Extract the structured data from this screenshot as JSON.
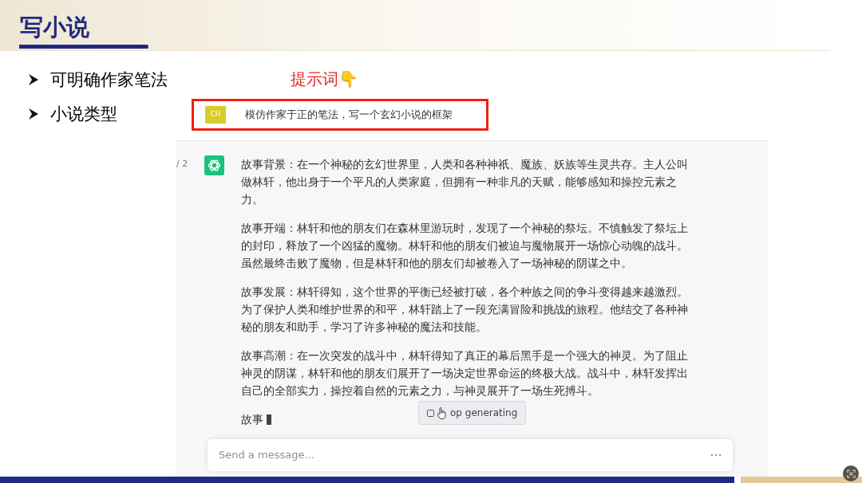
{
  "slide": {
    "title": "写小说",
    "bullets": [
      "可明确作家笔法",
      "小说类型"
    ],
    "annotation": "提示词👇"
  },
  "chat": {
    "prompt": {
      "avatar": "CH",
      "text": "模仿作家于正的笔法，写一个玄幻小说的框架"
    },
    "response": {
      "pager": "/ 2",
      "paragraphs": [
        "故事背景：在一个神秘的玄幻世界里，人类和各种神祇、魔族、妖族等生灵共存。主人公叫做林轩，他出身于一个平凡的人类家庭，但拥有一种非凡的天赋，能够感知和操控元素之力。",
        "故事开端：林轩和他的朋友们在森林里游玩时，发现了一个神秘的祭坛。不慎触发了祭坛上的封印，释放了一个凶猛的魔物。林轩和他的朋友们被迫与魔物展开一场惊心动魄的战斗。虽然最终击败了魔物，但是林轩和他的朋友们却被卷入了一场神秘的阴谋之中。",
        "故事发展：林轩得知，这个世界的平衡已经被打破，各个种族之间的争斗变得越来越激烈。为了保护人类和维护世界的和平，林轩踏上了一段充满冒险和挑战的旅程。他结交了各种神秘的朋友和助手，学习了许多神秘的魔法和技能。",
        "故事高潮：在一次突发的战斗中，林轩得知了真正的幕后黑手是一个强大的神灵。为了阻止神灵的阴谋，林轩和他的朋友们展开了一场决定世界命运的终极大战。战斗中，林轩发挥出自己的全部实力，操控着自然的元素之力，与神灵展开了一场生死搏斗。"
      ],
      "partial": "故事"
    },
    "stop_button": "op generating",
    "input": {
      "placeholder": "Send a message..."
    }
  }
}
